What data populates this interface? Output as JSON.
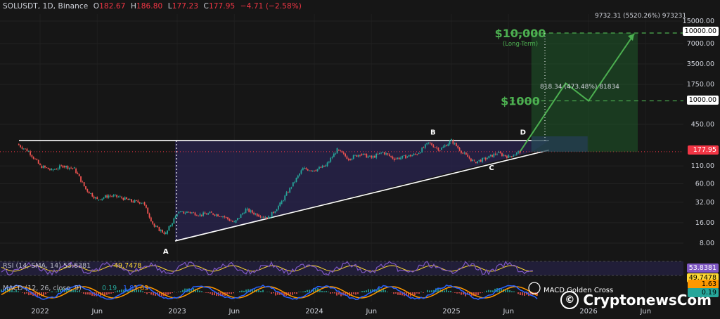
{
  "header": {
    "symbol": "SOLUSDT, 1D, Binance",
    "open_label": "O",
    "open": "182.67",
    "high_label": "H",
    "high": "186.80",
    "low_label": "L",
    "low": "177.23",
    "close_label": "C",
    "close": "177.95",
    "change": "−4.71 (−2.58%)"
  },
  "chart_data": {
    "type": "line",
    "scale": "log",
    "y_ticks": [
      "15000.00",
      "7000.00",
      "3500.00",
      "1750.00",
      "450.00",
      "110.00",
      "60.00",
      "32.00",
      "16.00",
      "8.00"
    ],
    "x_ticks": [
      "2022",
      "Jun",
      "2023",
      "Jun",
      "2024",
      "Jun",
      "2025",
      "Jun",
      "2026",
      "Jun"
    ],
    "price_series": [
      {
        "date": "2021-11",
        "value": 230
      },
      {
        "date": "2021-12",
        "value": 180
      },
      {
        "date": "2022-01",
        "value": 110
      },
      {
        "date": "2022-02",
        "value": 95
      },
      {
        "date": "2022-03",
        "value": 110
      },
      {
        "date": "2022-04",
        "value": 100
      },
      {
        "date": "2022-05",
        "value": 50
      },
      {
        "date": "2022-06",
        "value": 35
      },
      {
        "date": "2022-07",
        "value": 40
      },
      {
        "date": "2022-08",
        "value": 38
      },
      {
        "date": "2022-09",
        "value": 33
      },
      {
        "date": "2022-10",
        "value": 32
      },
      {
        "date": "2022-11",
        "value": 14
      },
      {
        "date": "2022-12",
        "value": 11
      },
      {
        "date": "2023-01",
        "value": 22
      },
      {
        "date": "2023-02",
        "value": 23
      },
      {
        "date": "2023-03",
        "value": 21
      },
      {
        "date": "2023-04",
        "value": 22
      },
      {
        "date": "2023-05",
        "value": 20
      },
      {
        "date": "2023-06",
        "value": 16
      },
      {
        "date": "2023-07",
        "value": 25
      },
      {
        "date": "2023-08",
        "value": 21
      },
      {
        "date": "2023-09",
        "value": 19
      },
      {
        "date": "2023-10",
        "value": 30
      },
      {
        "date": "2023-11",
        "value": 55
      },
      {
        "date": "2023-12",
        "value": 100
      },
      {
        "date": "2024-01",
        "value": 95
      },
      {
        "date": "2024-02",
        "value": 110
      },
      {
        "date": "2024-03",
        "value": 190
      },
      {
        "date": "2024-04",
        "value": 140
      },
      {
        "date": "2024-05",
        "value": 165
      },
      {
        "date": "2024-06",
        "value": 145
      },
      {
        "date": "2024-07",
        "value": 175
      },
      {
        "date": "2024-08",
        "value": 140
      },
      {
        "date": "2024-09",
        "value": 150
      },
      {
        "date": "2024-10",
        "value": 165
      },
      {
        "date": "2024-11",
        "value": 240
      },
      {
        "date": "2024-12",
        "value": 190
      },
      {
        "date": "2025-01",
        "value": 260
      },
      {
        "date": "2025-02",
        "value": 170
      },
      {
        "date": "2025-03",
        "value": 125
      },
      {
        "date": "2025-04",
        "value": 140
      },
      {
        "date": "2025-05",
        "value": 170
      },
      {
        "date": "2025-06",
        "value": 150
      },
      {
        "date": "2025-07",
        "value": 178
      }
    ],
    "resistance": "≈260",
    "point_labels": [
      "A",
      "B",
      "C",
      "D"
    ],
    "projection_path": [
      {
        "date": "2025-07",
        "value": 178
      },
      {
        "date": "2025-11",
        "value": 1818
      },
      {
        "date": "2026-01",
        "value": 1000
      },
      {
        "date": "2026-05",
        "value": 9732
      }
    ],
    "targets": [
      {
        "label": "$10,000",
        "sublabel": "(Long-Term)",
        "value": 10000
      },
      {
        "label": "$1000",
        "value": 1000
      }
    ],
    "measure_labels": [
      "9732.31 (5520.26%) 973231",
      "818.34 (473.48%) 81834"
    ],
    "rsi": {
      "label": "RSI (14, SMA, 14)",
      "value1": "53.8381",
      "value2": "49.7478"
    },
    "macd": {
      "label": "MACD (12, 26, close, 9)",
      "value1": "0.19",
      "value2": "1.82",
      "value3": "1.63",
      "annotation": "MACD Golden Cross"
    }
  },
  "price_labels": {
    "p10000": "10000.00",
    "p1000": "1000.00",
    "current": "177.95",
    "rsi1": "53.8381",
    "rsi2": "49.7478",
    "macd1": "1.63",
    "macd2": "0.19"
  },
  "colors": {
    "up": "#26a69a",
    "down": "#ef5350",
    "target": "#4caf50",
    "triangle_fill": "#2a2450",
    "rsi_line": "#7e57c2",
    "rsi_ma": "#fdd835",
    "macd_line": "#2962ff",
    "signal_line": "#ff9800"
  },
  "watermark": {
    "icon": "©",
    "text": "Cryptonews",
    "suffix": "Com"
  }
}
